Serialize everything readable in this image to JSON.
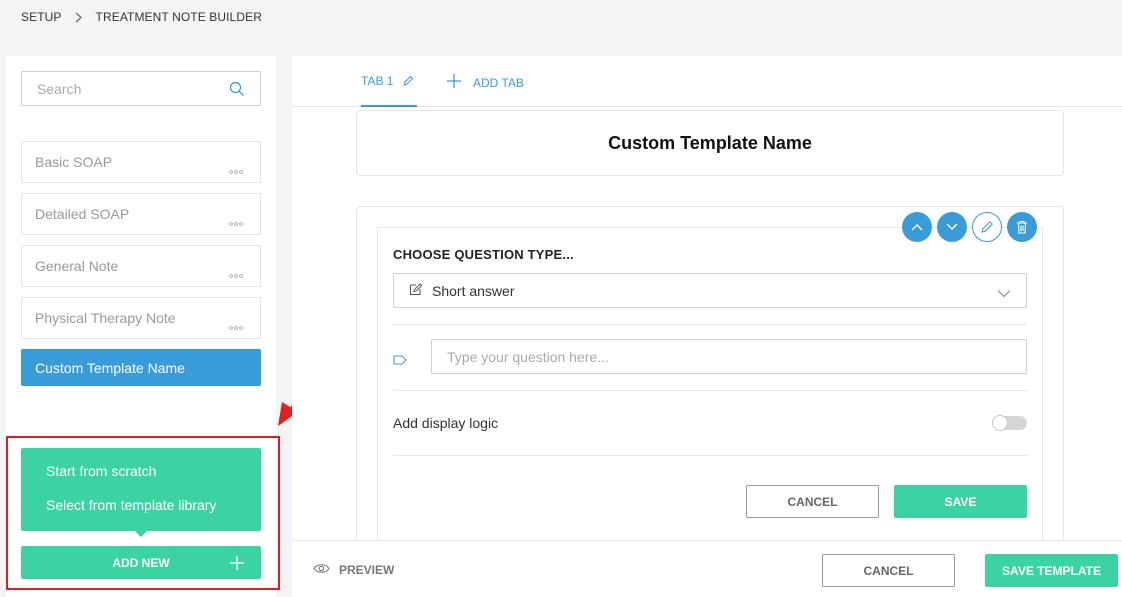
{
  "breadcrumb": {
    "items": [
      "SETUP",
      "TREATMENT NOTE BUILDER"
    ]
  },
  "sidebar": {
    "search": {
      "placeholder": "Search"
    },
    "templates": [
      {
        "label": "Basic SOAP"
      },
      {
        "label": "Detailed SOAP"
      },
      {
        "label": "General Note"
      },
      {
        "label": "Physical Therapy Note"
      }
    ],
    "active_template": {
      "label": "Custom Template Name"
    },
    "add_menu": {
      "items": [
        "Start from scratch",
        "Select from template library"
      ]
    },
    "add_new_label": "ADD NEW"
  },
  "tabs": {
    "tab1": "TAB 1",
    "add_tab": "ADD TAB"
  },
  "template_title": "Custom Template Name",
  "question": {
    "type_label": "CHOOSE QUESTION TYPE...",
    "type_value": "Short answer",
    "question_placeholder": "Type your question here...",
    "display_logic_label": "Add display logic",
    "display_logic_on": false,
    "cancel_label": "CANCEL",
    "save_label": "SAVE"
  },
  "footer": {
    "preview_label": "PREVIEW",
    "cancel_label": "CANCEL",
    "save_template_label": "SAVE TEMPLATE"
  },
  "colors": {
    "accent_blue": "#3a9bd9",
    "accent_green": "#3bd3a4",
    "highlight_red": "#d92020"
  }
}
